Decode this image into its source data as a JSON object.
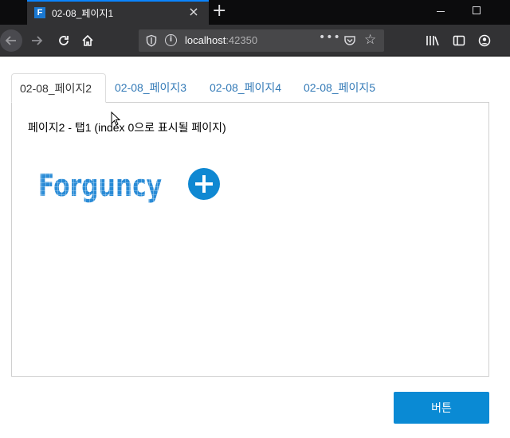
{
  "browser": {
    "tab_title": "02-08_페이지1",
    "favicon_letter": "F",
    "close_glyph": "×",
    "newtab_glyph": "+",
    "url_host": "localhost",
    "url_port": ":42350",
    "url_more_glyph": "•••",
    "icons": [
      "back-arrow-icon",
      "forward-arrow-icon",
      "reload-icon",
      "home-icon",
      "shield-icon",
      "info-icon",
      "pocket-icon",
      "star-icon",
      "library-icon",
      "sidebar-icon",
      "account-icon"
    ]
  },
  "page": {
    "tabs": [
      {
        "label": "02-08_페이지2",
        "active": true
      },
      {
        "label": "02-08_페이지3",
        "active": false
      },
      {
        "label": "02-08_페이지4",
        "active": false
      },
      {
        "label": "02-08_페이지5",
        "active": false
      }
    ],
    "panel_text": "페이지2 - 탭1 (index 0으로 표시될 페이지)",
    "logo_text": "Forguncy",
    "button_label": "버튼"
  },
  "colors": {
    "accent": "#0a8ad4",
    "link": "#337ab7",
    "chrome_dark": "#0c0c0d",
    "chrome_toolbar": "#323234"
  }
}
